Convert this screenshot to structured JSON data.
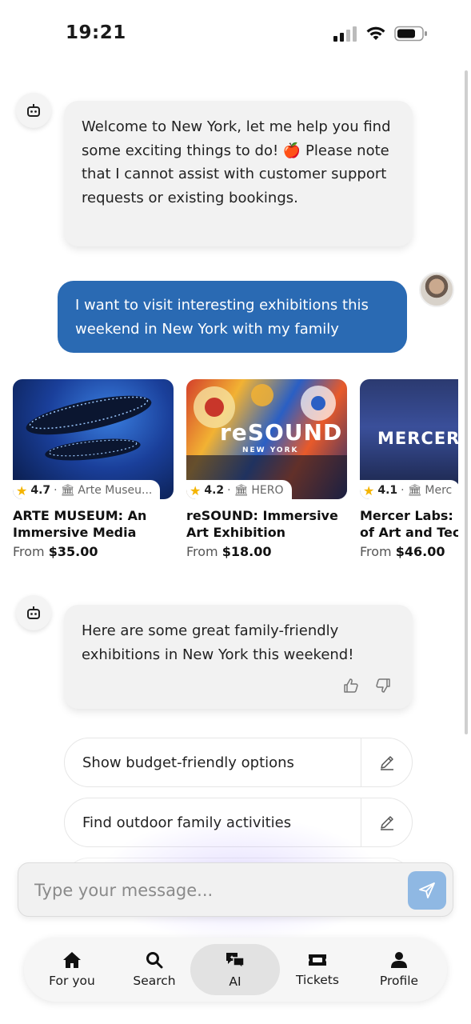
{
  "status_bar": {
    "time": "19:21"
  },
  "messages": {
    "bot_welcome": "Welcome to New York, let me help you find some exciting things to do! 🍎 Please note that I cannot assist with customer support requests or existing bookings.",
    "user_request": "I want to visit interesting exhibitions this weekend in New York with my family",
    "bot_reply": "Here are some great family-friendly exhibitions in New York this weekend!"
  },
  "cards": [
    {
      "rating": "4.7",
      "venue": "Arte Museu...",
      "title": "ARTE MUSEUM: An Immersive Media Art...",
      "price_prefix": "From",
      "price": "$35.00",
      "image_text": ""
    },
    {
      "rating": "4.2",
      "venue": "HERO",
      "title": "reSOUND: Immersive Art Exhibition",
      "price_prefix": "From",
      "price": "$18.00",
      "image_text": "reSOUND",
      "image_subtext": "NEW YORK"
    },
    {
      "rating": "4.1",
      "venue": "Merc",
      "title": "Mercer Labs: Museum of Art and Technology",
      "price_prefix": "From",
      "price": "$46.00",
      "image_text": "MERCER"
    }
  ],
  "suggestions": [
    {
      "label": "Show budget-friendly options"
    },
    {
      "label": "Find outdoor family activities"
    }
  ],
  "input": {
    "placeholder": "Type your message..."
  },
  "nav": [
    {
      "label": "For you",
      "icon": "home-icon"
    },
    {
      "label": "Search",
      "icon": "search-icon"
    },
    {
      "label": "AI",
      "icon": "ai-chat-icon",
      "active": true
    },
    {
      "label": "Tickets",
      "icon": "ticket-icon"
    },
    {
      "label": "Profile",
      "icon": "profile-icon"
    }
  ],
  "colors": {
    "user_bubble": "#2a6ab3",
    "send_button": "#8fb8e3",
    "star": "#f4b400"
  }
}
